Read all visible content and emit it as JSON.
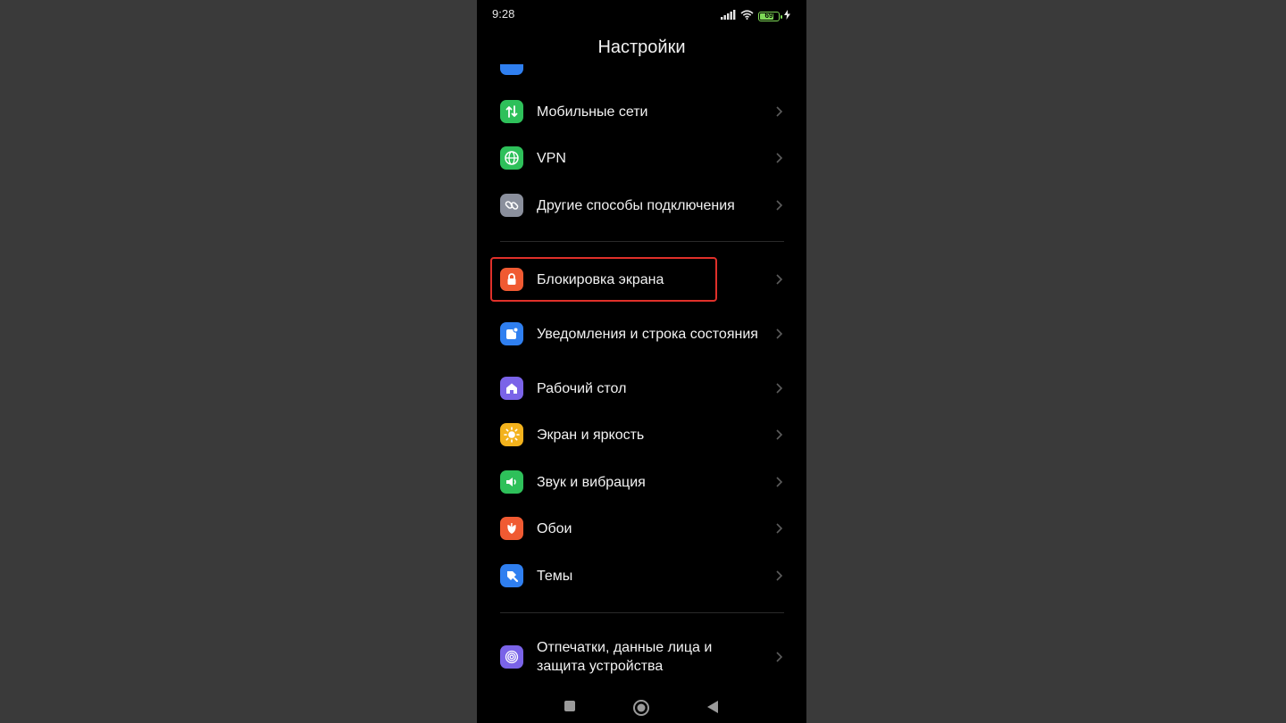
{
  "status_bar": {
    "time": "9:28",
    "battery_level": "69",
    "icons": [
      "signal-icon",
      "wifi-icon",
      "battery-icon",
      "charging-icon"
    ]
  },
  "header": {
    "title": "Настройки"
  },
  "settings": {
    "group1": [
      {
        "label": "Мобильные сети",
        "icon": "mobile-network-icon",
        "color": "#2ec05a"
      },
      {
        "label": "VPN",
        "icon": "globe-icon",
        "color": "#2ec05a"
      },
      {
        "label": "Другие способы подключения",
        "icon": "link-icon",
        "color": "#8a8f9c"
      }
    ],
    "group2": [
      {
        "label": "Блокировка экрана",
        "icon": "lock-icon",
        "color": "#f05a32",
        "highlighted": true
      },
      {
        "label": "Уведомления и строка состояния",
        "icon": "notification-icon",
        "color": "#2f7ff0"
      },
      {
        "label": "Рабочий стол",
        "icon": "home-icon",
        "color": "#7a63e8"
      },
      {
        "label": "Экран и яркость",
        "icon": "sun-icon",
        "color": "#f3b21c"
      },
      {
        "label": "Звук и вибрация",
        "icon": "speaker-icon",
        "color": "#2ec05a"
      },
      {
        "label": "Обои",
        "icon": "wallpaper-icon",
        "color": "#f05a32"
      },
      {
        "label": "Темы",
        "icon": "brush-icon",
        "color": "#2f7ff0"
      }
    ],
    "group3": [
      {
        "label": "Отпечатки, данные лица и защита устройства",
        "icon": "fingerprint-icon",
        "color": "#7a63e8"
      }
    ]
  },
  "colors": {
    "background": "#3a3a3a",
    "phone_background": "#000000",
    "highlight": "#e0302a"
  }
}
